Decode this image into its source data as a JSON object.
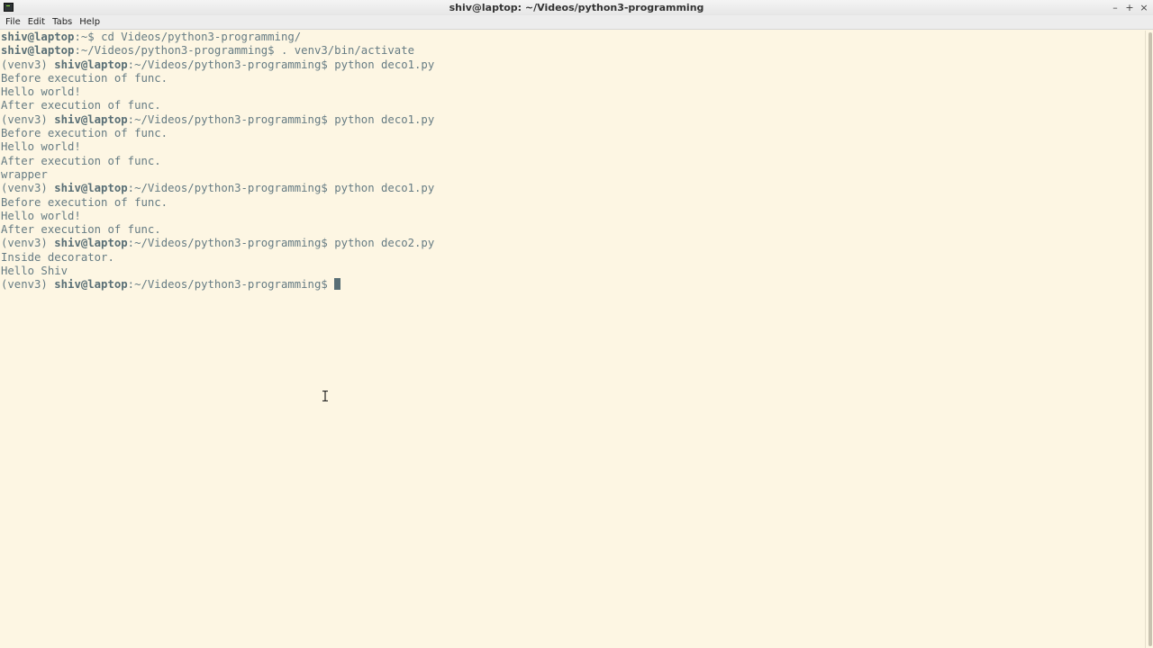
{
  "window": {
    "title": "shiv@laptop: ~/Videos/python3-programming",
    "controls": {
      "minimize": "–",
      "maximize": "+",
      "close": "×"
    }
  },
  "menubar": {
    "items": [
      "File",
      "Edit",
      "Tabs",
      "Help"
    ]
  },
  "terminal": {
    "lines": [
      {
        "venv": "",
        "user": "shiv@laptop",
        "path": ":~$ ",
        "cmd": "cd Videos/python3-programming/"
      },
      {
        "venv": "",
        "user": "shiv@laptop",
        "path": ":~/Videos/python3-programming$ ",
        "cmd": ". venv3/bin/activate"
      },
      {
        "venv": "(venv3) ",
        "user": "shiv@laptop",
        "path": ":~/Videos/python3-programming$ ",
        "cmd": "python deco1.py"
      },
      {
        "text": "Before execution of func."
      },
      {
        "text": "Hello world!"
      },
      {
        "text": "After execution of func."
      },
      {
        "venv": "(venv3) ",
        "user": "shiv@laptop",
        "path": ":~/Videos/python3-programming$ ",
        "cmd": "python deco1.py"
      },
      {
        "text": "Before execution of func."
      },
      {
        "text": "Hello world!"
      },
      {
        "text": "After execution of func."
      },
      {
        "text": "wrapper"
      },
      {
        "venv": "(venv3) ",
        "user": "shiv@laptop",
        "path": ":~/Videos/python3-programming$ ",
        "cmd": "python deco1.py"
      },
      {
        "text": "Before execution of func."
      },
      {
        "text": "Hello world!"
      },
      {
        "text": "After execution of func."
      },
      {
        "venv": "(venv3) ",
        "user": "shiv@laptop",
        "path": ":~/Videos/python3-programming$ ",
        "cmd": "python deco2.py"
      },
      {
        "text": "Inside decorator."
      },
      {
        "text": "Hello Shiv"
      },
      {
        "venv": "(venv3) ",
        "user": "shiv@laptop",
        "path": ":~/Videos/python3-programming$ ",
        "cmd": "",
        "cursor": true
      }
    ]
  },
  "colors": {
    "background": "#fdf6e3",
    "text": "#657b83",
    "user": "#586e75"
  }
}
